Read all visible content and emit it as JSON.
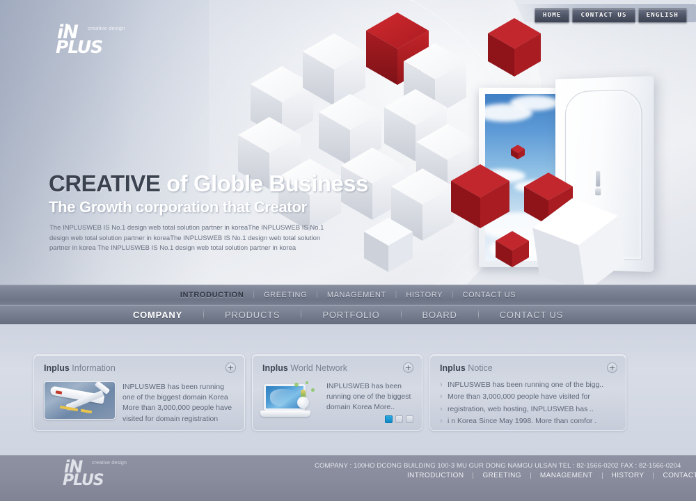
{
  "topnav": {
    "items": [
      {
        "label": "HOME",
        "name": "home"
      },
      {
        "label": "CONTACT US",
        "name": "contact-us"
      },
      {
        "label": "ENGLISH",
        "name": "english"
      }
    ]
  },
  "logo": {
    "main_in": "iN",
    "main_plus": "PLUS",
    "tagline": "creative design"
  },
  "hero": {
    "headline_strong": "CREATIVE",
    "headline_light": " of Globle Business",
    "subheadline": "The Growth corporation that Creator",
    "description": "The INPLUSWEB IS No.1 design web total solution partner in koreaThe INPLUSWEB IS No.1 design web total solution partner in koreaThe INPLUSWEB IS No.1 design web total solution partner in korea\nThe INPLUSWEB IS No.1 design web total solution partner in korea"
  },
  "nav_primary": {
    "items": [
      {
        "label": "INTRODUCTION",
        "active": true
      },
      {
        "label": "GREETING",
        "active": false
      },
      {
        "label": "MANAGEMENT",
        "active": false
      },
      {
        "label": "HISTORY",
        "active": false
      },
      {
        "label": "CONTACT US",
        "active": false
      }
    ]
  },
  "nav_secondary": {
    "items": [
      {
        "label": "COMPANY",
        "active": true
      },
      {
        "label": "PRODUCTS",
        "active": false
      },
      {
        "label": "PORTFOLIO",
        "active": false
      },
      {
        "label": "BOARD",
        "active": false
      },
      {
        "label": "CONTACT US",
        "active": false
      }
    ]
  },
  "panels": {
    "information": {
      "title_strong": "Inplus",
      "title_light": "Information",
      "plus_label": "+",
      "text": "INPLUSWEB has been running one of the biggest domain Korea More than 3,000,000 people have visited for domain registration",
      "thumbnail_icon": "airplane-photo"
    },
    "world_network": {
      "title_strong": "Inplus",
      "title_light": "World Network",
      "plus_label": "+",
      "text": "INPLUSWEB has been running one of the biggest domain Korea More..",
      "illustration_icon": "laptop-lightbulb",
      "pagination": [
        {
          "index": 1,
          "active": true
        },
        {
          "index": 2,
          "active": false
        },
        {
          "index": 3,
          "active": false
        }
      ]
    },
    "notice": {
      "title_strong": "Inplus",
      "title_light": "Notice",
      "plus_label": "+",
      "items": [
        "INPLUSWEB has been running one of the bigg..",
        "More than 3,000,000 people have visited for",
        "registration, web hosting, INPLUSWEB has ..",
        "i n Korea  Since May 1998. More than comfor ."
      ]
    }
  },
  "footer": {
    "company_line": "COMPANY :  100HO DCONG BUILDING 100-3 MU GUR DONG NAMGU ULSAN  TEL :  82-1566-0202  FAX :  82-1566-0204",
    "nav": [
      {
        "label": "INTRODUCTION"
      },
      {
        "label": "GREETING"
      },
      {
        "label": "MANAGEMENT"
      },
      {
        "label": "HISTORY"
      },
      {
        "label": "CONTACT US"
      }
    ]
  },
  "colors": {
    "accent_red": "#b52026",
    "nav_bar": "#7a8192",
    "footer_bg": "#888c9c",
    "pager_active": "#0f86c4",
    "headline_dark": "#3c4350"
  }
}
